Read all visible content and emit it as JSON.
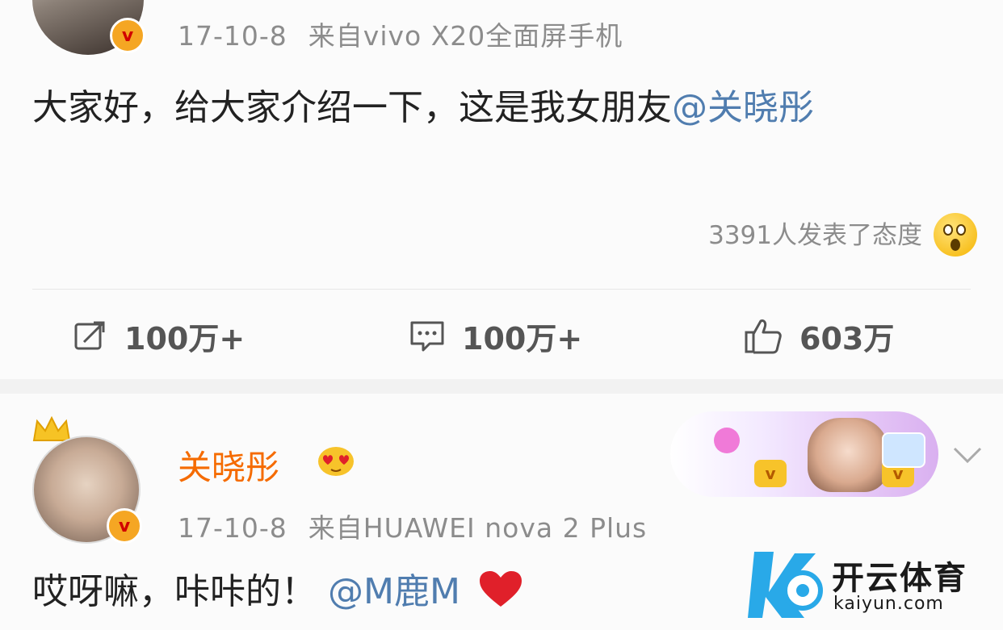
{
  "post1": {
    "date": "17-10-8",
    "source": "来自vivo X20全面屏手机",
    "text_plain": "大家好，给大家介绍一下，这是我女朋友",
    "mention": "@关晓彤",
    "reaction_text": "3391人发表了态度",
    "repost_count": "100万+",
    "comment_count": "100万+",
    "like_count": "603万",
    "verified_badge": "v"
  },
  "post2": {
    "username": "关晓彤",
    "date": "17-10-8",
    "source": "来自HUAWEI nova 2 Plus",
    "text_plain": "哎呀嘛，咔咔的！",
    "mention": "@M鹿M",
    "verified_badge": "v"
  },
  "watermark": {
    "name": "开云体育",
    "url": "kaiyun.com"
  },
  "colors": {
    "mention": "#507daf",
    "username": "#f56b00",
    "meta": "#8c8c8c",
    "heart": "#e0202a"
  }
}
